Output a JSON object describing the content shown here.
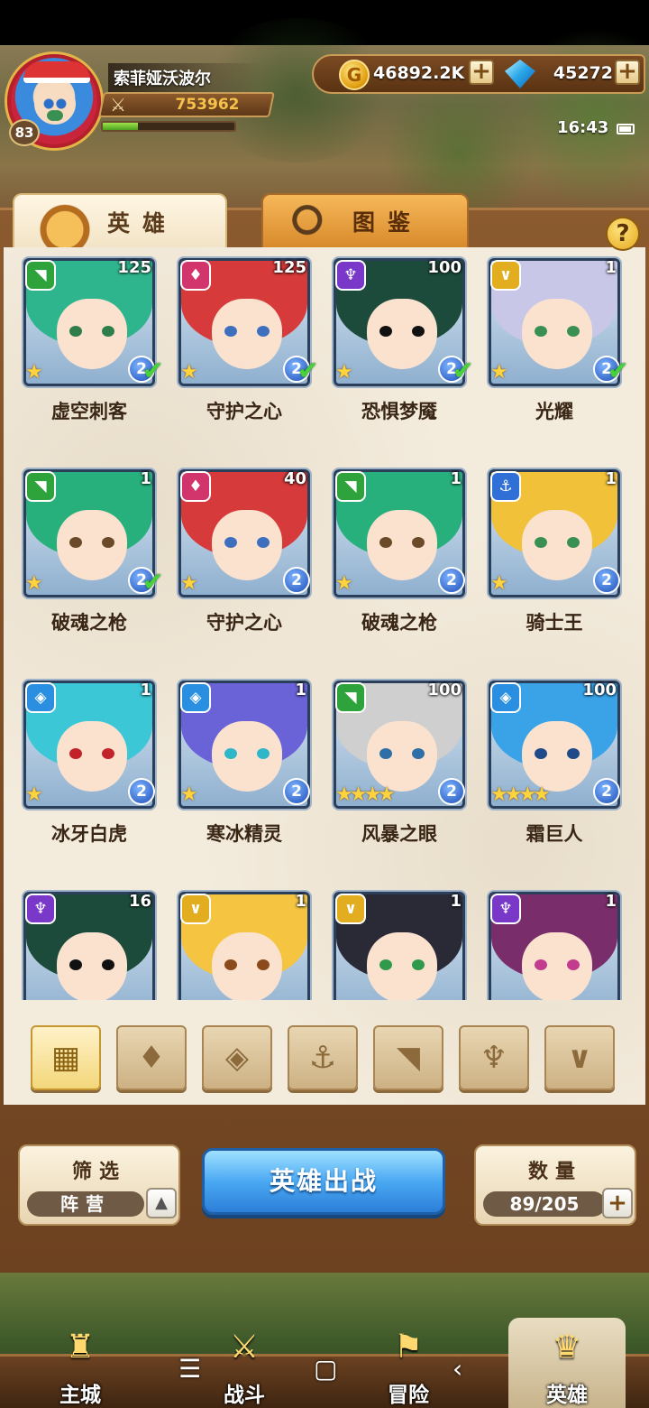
{
  "player": {
    "name": "索菲娅沃波尔",
    "level": "83",
    "power": "753962",
    "xp_fraction": 0.27
  },
  "currency": {
    "gold": "46892.2K",
    "gems": "45272",
    "plus": "+"
  },
  "status": {
    "time": "16:43"
  },
  "tabs": {
    "heroes": "英雄",
    "codex": "图鉴"
  },
  "help": "?",
  "heroes": [
    {
      "name": "虚空刺客",
      "level": "125",
      "faction": "beast",
      "faction_glyph": "◥",
      "faction_color": "#2fa33b",
      "stars": "★",
      "quality": "2",
      "checked": true,
      "hair": "#2fb58d",
      "eye": "#2e7d4a"
    },
    {
      "name": "守护之心",
      "level": "125",
      "faction": "nature",
      "faction_glyph": "♦",
      "faction_color": "#d1356b",
      "stars": "★",
      "quality": "2",
      "checked": true,
      "hair": "#d63a3a",
      "eye": "#3e6fbf"
    },
    {
      "name": "恐惧梦魇",
      "level": "100",
      "faction": "dark",
      "faction_glyph": "♆",
      "faction_color": "#7a38c9",
      "stars": "★",
      "quality": "2",
      "checked": true,
      "hair": "#1d4b3b",
      "eye": "#111111"
    },
    {
      "name": "光耀",
      "level": "1",
      "faction": "light",
      "faction_glyph": "∨",
      "faction_color": "#e2ad1e",
      "stars": "★",
      "quality": "2",
      "checked": true,
      "hair": "#c9c7e8",
      "eye": "#3a8f53"
    },
    {
      "name": "破魂之枪",
      "level": "1",
      "faction": "beast",
      "faction_glyph": "◥",
      "faction_color": "#2fa33b",
      "stars": "★",
      "quality": "2",
      "checked": true,
      "hair": "#27b07c",
      "eye": "#6b4a2a"
    },
    {
      "name": "守护之心",
      "level": "40",
      "faction": "nature",
      "faction_glyph": "♦",
      "faction_color": "#d1356b",
      "stars": "★",
      "quality": "2",
      "checked": false,
      "hair": "#d63a3a",
      "eye": "#3e6fbf"
    },
    {
      "name": "破魂之枪",
      "level": "1",
      "faction": "beast",
      "faction_glyph": "◥",
      "faction_color": "#2fa33b",
      "stars": "★",
      "quality": "2",
      "checked": false,
      "hair": "#27b07c",
      "eye": "#6b4a2a"
    },
    {
      "name": "骑士王",
      "level": "1",
      "faction": "anchor",
      "faction_glyph": "⚓",
      "faction_color": "#2f6fd6",
      "stars": "★",
      "quality": "2",
      "checked": false,
      "hair": "#f2c13a",
      "eye": "#3a8f53"
    },
    {
      "name": "冰牙白虎",
      "level": "1",
      "faction": "water",
      "faction_glyph": "◈",
      "faction_color": "#2a8fe0",
      "stars": "★",
      "quality": "2",
      "checked": false,
      "hair": "#3cc7d6",
      "eye": "#c2232b"
    },
    {
      "name": "寒冰精灵",
      "level": "1",
      "faction": "water",
      "faction_glyph": "◈",
      "faction_color": "#2a8fe0",
      "stars": "★",
      "quality": "2",
      "checked": false,
      "hair": "#6a63d8",
      "eye": "#2fb7c9"
    },
    {
      "name": "风暴之眼",
      "level": "100",
      "faction": "beast",
      "faction_glyph": "◥",
      "faction_color": "#2fa33b",
      "stars": "★★★★",
      "quality": "2",
      "checked": false,
      "hair": "#cfcfcf",
      "eye": "#2f6fa8"
    },
    {
      "name": "霜巨人",
      "level": "100",
      "faction": "water",
      "faction_glyph": "◈",
      "faction_color": "#2a8fe0",
      "stars": "★★★★",
      "quality": "2",
      "checked": false,
      "hair": "#3aa3e8",
      "eye": "#1e4a8a"
    },
    {
      "name": "",
      "level": "16",
      "faction": "dark",
      "faction_glyph": "♆",
      "faction_color": "#7a38c9",
      "stars": "",
      "quality": "",
      "checked": false,
      "hair": "#1d4b3b",
      "eye": "#111111"
    },
    {
      "name": "",
      "level": "1",
      "faction": "light",
      "faction_glyph": "∨",
      "faction_color": "#e2ad1e",
      "stars": "",
      "quality": "",
      "checked": false,
      "hair": "#f5c542",
      "eye": "#8a4a1a"
    },
    {
      "name": "",
      "level": "1",
      "faction": "light",
      "faction_glyph": "∨",
      "faction_color": "#e2ad1e",
      "stars": "",
      "quality": "",
      "checked": false,
      "hair": "#2a2a36",
      "eye": "#2f9a4a"
    },
    {
      "name": "",
      "level": "1",
      "faction": "dark",
      "faction_glyph": "♆",
      "faction_color": "#7a38c9",
      "stars": "",
      "quality": "",
      "checked": false,
      "hair": "#7a2d6b",
      "eye": "#c23b8f"
    }
  ],
  "faction_filters": [
    {
      "name": "all",
      "glyph": "▦"
    },
    {
      "name": "nature",
      "glyph": "♦"
    },
    {
      "name": "water",
      "glyph": "◈"
    },
    {
      "name": "anchor",
      "glyph": "⚓"
    },
    {
      "name": "beast",
      "glyph": "◥"
    },
    {
      "name": "dark",
      "glyph": "♆"
    },
    {
      "name": "light",
      "glyph": "∨"
    }
  ],
  "controls": {
    "filter_title": "筛选",
    "filter_value": "阵营",
    "deploy": "英雄出战",
    "count_title": "数量",
    "count_value": "89/205",
    "arrow_up": "▲",
    "plus": "+"
  },
  "nav": [
    {
      "label": "主城",
      "icon": "castle-icon",
      "glyph": "♜"
    },
    {
      "label": "战斗",
      "icon": "crossed-swords-icon",
      "glyph": "⚔"
    },
    {
      "label": "冒险",
      "icon": "map-icon",
      "glyph": "⚑"
    },
    {
      "label": "英雄",
      "icon": "hero-helmet-icon",
      "glyph": "♛"
    }
  ],
  "system_nav": {
    "menu": "☰",
    "home": "▢",
    "back": "‹"
  }
}
